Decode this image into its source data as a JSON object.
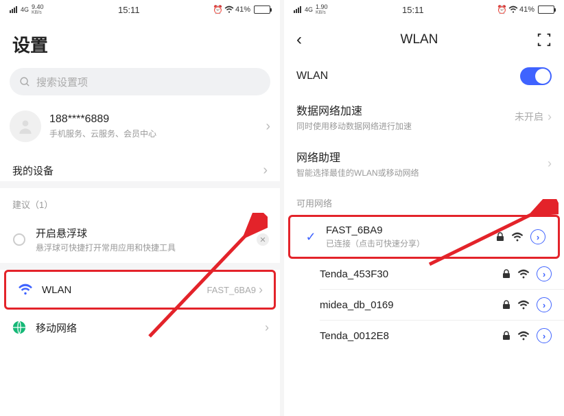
{
  "left": {
    "status": {
      "net": "4G",
      "speed": "9.40",
      "unit": "KB/s",
      "time": "15:11",
      "battery": "41%"
    },
    "title": "设置",
    "search_placeholder": "搜索设置项",
    "account": {
      "phone": "188****6889",
      "sub": "手机服务、云服务、会员中心"
    },
    "my_devices": "我的设备",
    "suggestions_header": "建议（1）",
    "suggestion": {
      "title": "开启悬浮球",
      "sub": "悬浮球可快捷打开常用应用和快捷工具"
    },
    "wlan": {
      "label": "WLAN",
      "value": "FAST_6BA9"
    },
    "mobile_net": "移动网络"
  },
  "right": {
    "status": {
      "net": "4G",
      "speed": "1.90",
      "unit": "KB/s",
      "time": "15:11",
      "battery": "41%"
    },
    "title": "WLAN",
    "wlan_label": "WLAN",
    "accel": {
      "title": "数据网络加速",
      "sub": "同时使用移动数据网络进行加速",
      "value": "未开启"
    },
    "assistant": {
      "title": "网络助理",
      "sub": "智能选择最佳的WLAN或移动网络"
    },
    "available_header": "可用网络",
    "nets": [
      {
        "name": "FAST_6BA9",
        "sub": "已连接（点击可快速分享）",
        "connected": true
      },
      {
        "name": "Tenda_453F30"
      },
      {
        "name": "midea_db_0169"
      },
      {
        "name": "Tenda_0012E8"
      }
    ]
  }
}
